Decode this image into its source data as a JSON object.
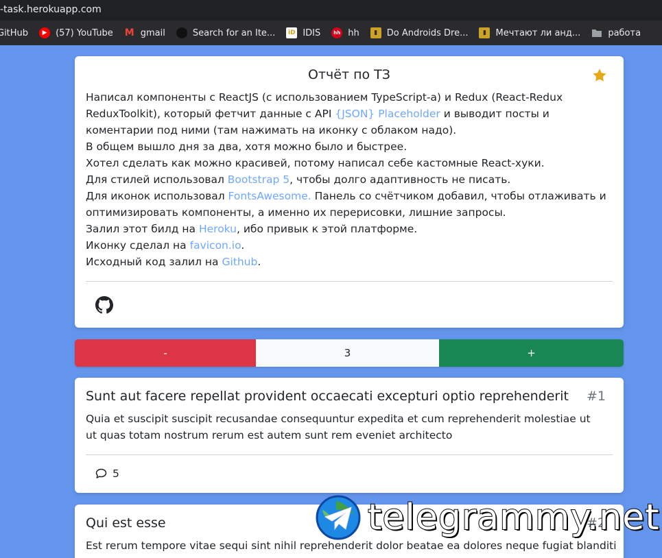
{
  "browser": {
    "url": "-task.herokuapp.com",
    "bookmarks": [
      {
        "label": "GitHub",
        "icon": "github-icon"
      },
      {
        "label": "(57) YouTube",
        "icon": "youtube-icon"
      },
      {
        "label": "gmail",
        "icon": "gmail-icon"
      },
      {
        "label": "Search for an Ite...",
        "icon": "search-site-icon"
      },
      {
        "label": "IDIS",
        "icon": "idis-icon"
      },
      {
        "label": "hh",
        "icon": "hh-icon"
      },
      {
        "label": "Do Androids Dre...",
        "icon": "book-icon"
      },
      {
        "label": "Мечтают ли анд...",
        "icon": "book-icon"
      },
      {
        "label": "работа",
        "icon": "folder-icon"
      }
    ]
  },
  "report": {
    "title": "Отчёт по ТЗ",
    "p1_a": "Написал компоненты с ReactJS (с использованием TypeScript-а) и Redux (React-Redux ReduxToolkit), который фетчит данные с API ",
    "p1_link": "{JSON} Placeholder",
    "p1_b": " и выводит посты и коментарии под ними (там нажимать на иконку с облаком надо).",
    "p2": "В общем вышло дня за два, хотя можно было и быстрее.",
    "p3": "Хотел сделать как можно красивей, потому написал себе кастомные React-хуки.",
    "p4_a": "Для стилей использовал ",
    "p4_link": "Bootstrap 5",
    "p4_b": ", чтобы долго адаптивность не писать.",
    "p5_a": "Для иконок использовал ",
    "p5_link": "FontsAwesome.",
    "p5_b": " Панель со счётчиком добавил, чтобы отлаживать и оптимизировать компоненты, а именно их перерисовки, лишние запросы.",
    "p6_a": "Залил этот билд на ",
    "p6_link": "Heroku",
    "p6_b": ", ибо привык к этой платформе.",
    "p7_a": "Иконку сделал на ",
    "p7_link": "favicon.io",
    "p7_b": ".",
    "p8_a": "Исходный код залил на ",
    "p8_link": "Github",
    "p8_b": "."
  },
  "counter": {
    "decrement": "-",
    "value": "3",
    "increment": "+"
  },
  "posts": [
    {
      "title": "Sunt aut facere repellat provident occaecati excepturi optio reprehenderit",
      "number": "#1",
      "body": "Quia et suscipit suscipit recusandae consequuntur expedita et cum reprehenderit molestiae ut ut quas totam nostrum rerum est autem sunt rem eveniet architecto",
      "comments": "5"
    },
    {
      "title": "Qui est esse",
      "number": "#2",
      "body": "Est rerum tempore vitae sequi sint nihil reprehenderit dolor beatae ea dolores neque fugiat blanditiis"
    }
  ],
  "watermark": {
    "text": "telegrammy.net"
  },
  "colors": {
    "background": "#6495ed",
    "danger": "#dc3545",
    "success": "#198754",
    "link": "#6ea8fe",
    "star": "#e6a817"
  }
}
